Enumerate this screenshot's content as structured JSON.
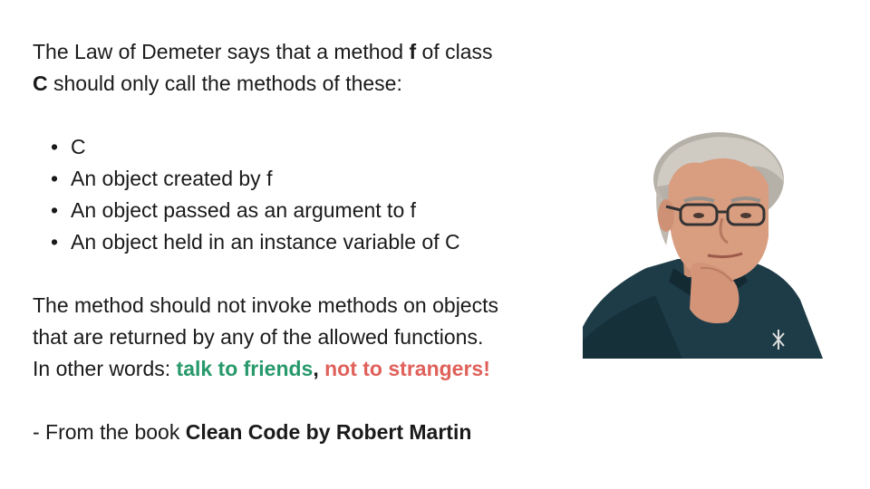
{
  "intro": {
    "line1_pre": "The Law of Demeter says that a method ",
    "f": "f",
    "line1_post": " of class",
    "c": "C",
    "line2_post": " should only call the methods of these:"
  },
  "bullets": [
    "C",
    "An object created by f",
    "An object passed as an argument to f",
    "An object held in an instance variable of C"
  ],
  "rule": {
    "line1": "The method should not invoke methods on objects",
    "line2": "that are returned by any of the allowed functions.",
    "line3_pre": "In other words: ",
    "friends": "talk to friends",
    "comma": ",",
    "strangers": "not to strangers!"
  },
  "source": {
    "pre": "- From the book ",
    "book": "Clean Code by Robert Martin"
  },
  "colors": {
    "friends": "#27996b",
    "strangers": "#e0605a"
  },
  "photo": {
    "subject": "portrait of Robert Martin"
  }
}
